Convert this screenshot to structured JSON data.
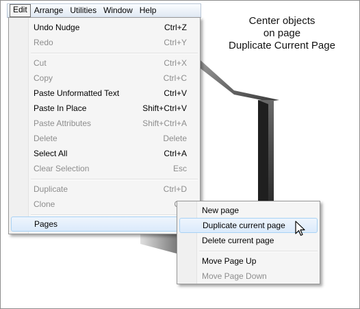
{
  "menubar": {
    "items": [
      {
        "label": "Edit"
      },
      {
        "label": "Arrange"
      },
      {
        "label": "Utilities"
      },
      {
        "label": "Window"
      },
      {
        "label": "Help"
      }
    ]
  },
  "caption": {
    "line1": "Center objects",
    "line2": "on page",
    "line3": "Duplicate Current Page"
  },
  "edit_menu": {
    "items": [
      {
        "label": "Undo Nudge",
        "shortcut": "Ctrl+Z",
        "enabled": true
      },
      {
        "label": "Redo",
        "shortcut": "Ctrl+Y",
        "enabled": false
      },
      {
        "label": "Cut",
        "shortcut": "Ctrl+X",
        "enabled": false
      },
      {
        "label": "Copy",
        "shortcut": "Ctrl+C",
        "enabled": false
      },
      {
        "label": "Paste Unformatted Text",
        "shortcut": "Ctrl+V",
        "enabled": true
      },
      {
        "label": "Paste In Place",
        "shortcut": "Shift+Ctrl+V",
        "enabled": true
      },
      {
        "label": "Paste Attributes",
        "shortcut": "Shift+Ctrl+A",
        "enabled": false
      },
      {
        "label": "Delete",
        "shortcut": "Delete",
        "enabled": false
      },
      {
        "label": "Select All",
        "shortcut": "Ctrl+A",
        "enabled": true
      },
      {
        "label": "Clear Selection",
        "shortcut": "Esc",
        "enabled": false
      },
      {
        "label": "Duplicate",
        "shortcut": "Ctrl+D",
        "enabled": false
      },
      {
        "label": "Clone",
        "shortcut": "Ctrl",
        "enabled": false
      },
      {
        "label": "Pages",
        "shortcut": "",
        "enabled": true
      }
    ]
  },
  "pages_menu": {
    "items": [
      {
        "label": "New page",
        "enabled": true
      },
      {
        "label": "Duplicate current page",
        "enabled": true
      },
      {
        "label": "Delete current page",
        "enabled": true
      },
      {
        "label": "Move Page Up",
        "enabled": true
      },
      {
        "label": "Move Page Down",
        "enabled": false
      }
    ]
  },
  "colors": {
    "highlight_border": "#a8d2f5",
    "disabled_text": "#8d8d8d",
    "menubar_top": "#fbfdff",
    "menubar_bottom": "#dfe8f3"
  },
  "icons": {
    "cursor": "arrow-pointer-icon"
  }
}
